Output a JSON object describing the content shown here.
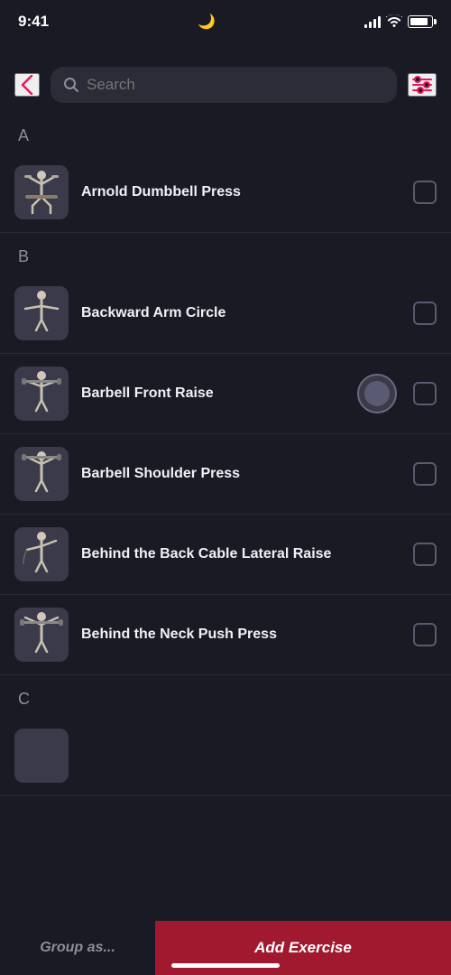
{
  "statusBar": {
    "time": "9:41",
    "moon": "🌙"
  },
  "header": {
    "backLabel": "‹",
    "searchPlaceholder": "Search",
    "filterLabel": "⚙"
  },
  "sections": [
    {
      "letter": "A",
      "exercises": [
        {
          "id": "arnold-dumbbell-press",
          "name": "Arnold Dumbbell Press",
          "checked": false,
          "hasRecord": false
        }
      ]
    },
    {
      "letter": "B",
      "exercises": [
        {
          "id": "backward-arm-circle",
          "name": "Backward Arm Circle",
          "checked": false,
          "hasRecord": false
        },
        {
          "id": "barbell-front-raise",
          "name": "Barbell Front Raise",
          "checked": false,
          "hasRecord": true
        },
        {
          "id": "barbell-shoulder-press",
          "name": "Barbell Shoulder Press",
          "checked": false,
          "hasRecord": false
        },
        {
          "id": "behind-back-cable",
          "name": "Behind the Back Cable Lateral Raise",
          "checked": false,
          "hasRecord": false
        },
        {
          "id": "behind-neck-push-press",
          "name": "Behind the Neck Push Press",
          "checked": false,
          "hasRecord": false
        }
      ]
    },
    {
      "letter": "C",
      "exercises": []
    }
  ],
  "bottomBar": {
    "groupAs": "Group as...",
    "addExercise": "Add Exercise"
  }
}
